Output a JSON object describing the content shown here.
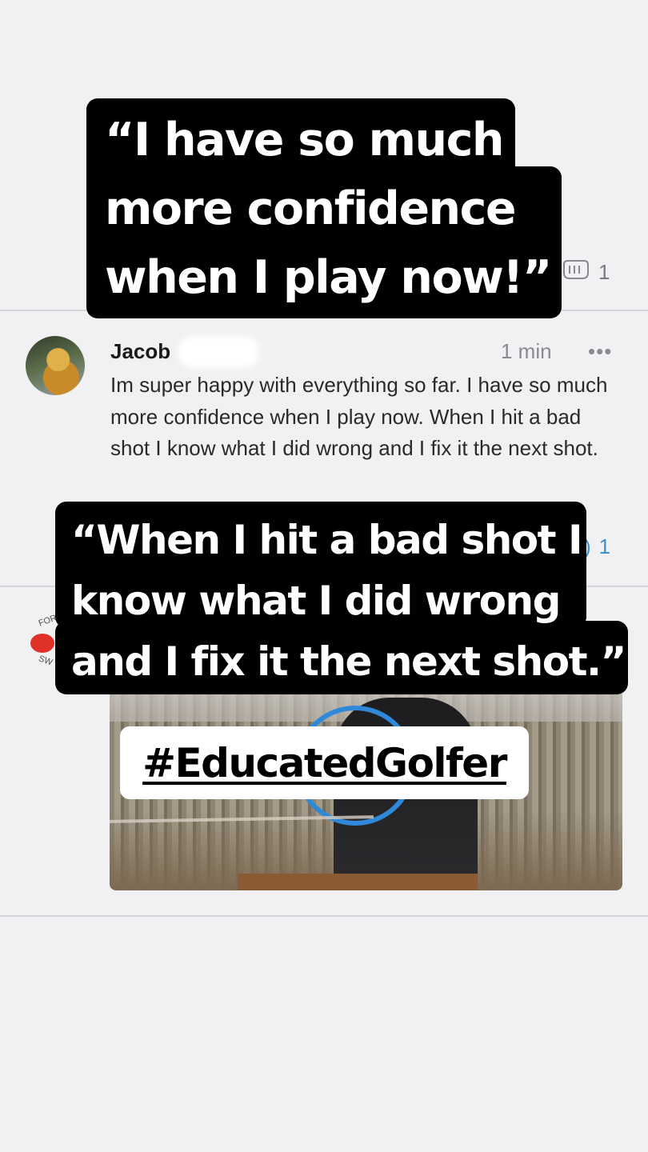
{
  "post1": {
    "reaction_count": "1"
  },
  "comment": {
    "author": "Jacob",
    "time": "1 min",
    "more": "•••",
    "text": "Im super happy with everything so far. I have so much more confidence when I play now. When I hit a bad shot I know what I did wrong and I fix it the next shot.",
    "reaction_count": "1"
  },
  "overlay": {
    "quote1": "“I have so much more confidence when I play now!”",
    "quote2": "“When I hit a bad shot I know what I did wrong and I fix it the next shot.”",
    "hashtag": "#EducatedGolfer"
  },
  "colors": {
    "background": "#f1f1f3",
    "caption_bg": "#000000",
    "accent_blue": "#3d8fce"
  }
}
